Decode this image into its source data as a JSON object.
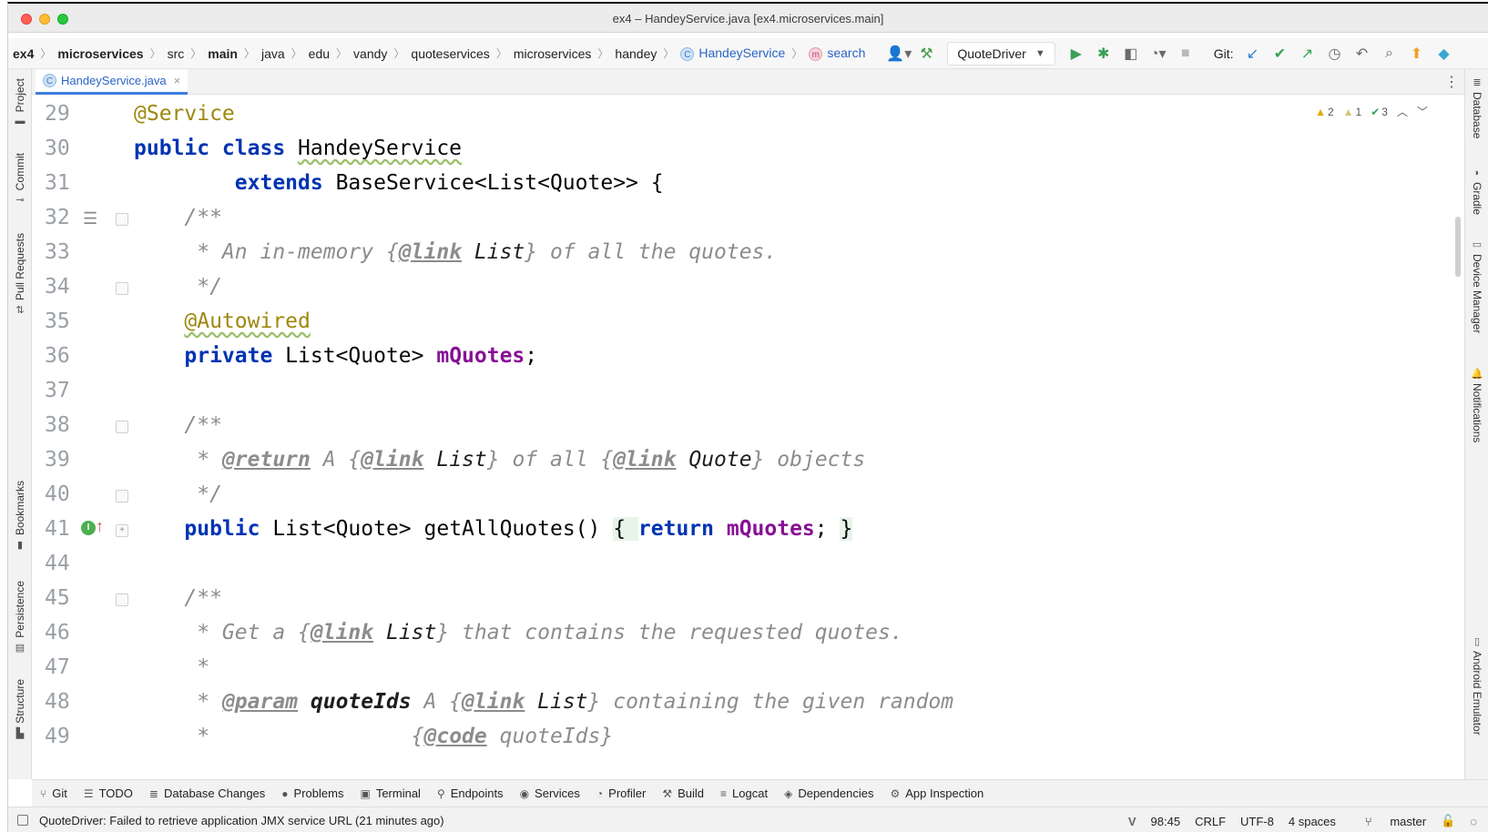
{
  "window": {
    "title": "ex4 – HandeyService.java [ex4.microservices.main]"
  },
  "breadcrumbs": [
    {
      "text": "ex4",
      "style": "bold"
    },
    {
      "text": "microservices",
      "style": "bold"
    },
    {
      "text": "src",
      "style": ""
    },
    {
      "text": "main",
      "style": "bold"
    },
    {
      "text": "java",
      "style": ""
    },
    {
      "text": "edu",
      "style": ""
    },
    {
      "text": "vandy",
      "style": ""
    },
    {
      "text": "quoteservices",
      "style": ""
    },
    {
      "text": "microservices",
      "style": ""
    },
    {
      "text": "handey",
      "style": ""
    }
  ],
  "breadcrumb_class": {
    "icon": "C",
    "label": "HandeyService"
  },
  "breadcrumb_method": {
    "icon": "m",
    "label": "search"
  },
  "toolbar": {
    "run_config": "QuoteDriver",
    "git_label": "Git:",
    "icons": [
      "user-icon",
      "hammer-icon",
      "run-icon",
      "debug-icon",
      "coverage-icon",
      "profile-icon",
      "stop-icon",
      "git-update-icon",
      "git-commit-icon",
      "git-push-icon",
      "history-icon",
      "rollback-icon",
      "search-icon",
      "update-icon",
      "plugin-icon"
    ]
  },
  "tab": {
    "icon": "C",
    "label": "HandeyService.java",
    "close": "×"
  },
  "inspections": {
    "warnings": "2",
    "weak_warnings": "1",
    "ok": "3"
  },
  "left_tools": [
    {
      "label": "Project",
      "icon": "folder-icon"
    },
    {
      "label": "Commit",
      "icon": "commit-icon"
    },
    {
      "label": "Pull Requests",
      "icon": "pull-request-icon"
    },
    {
      "label": "Bookmarks",
      "icon": "bookmark-icon"
    },
    {
      "label": "Persistence",
      "icon": "persistence-icon"
    },
    {
      "label": "Structure",
      "icon": "structure-icon"
    }
  ],
  "right_tools": [
    {
      "label": "Database",
      "icon": "database-icon"
    },
    {
      "label": "Gradle",
      "icon": "gradle-icon"
    },
    {
      "label": "Device Manager",
      "icon": "device-icon"
    },
    {
      "label": "Notifications",
      "icon": "bell-icon"
    },
    {
      "label": "Android Emulator",
      "icon": "emulator-icon"
    }
  ],
  "code_lines": [
    {
      "num": "29",
      "segs": [
        {
          "t": "@Service",
          "c": "ann"
        }
      ]
    },
    {
      "num": "30",
      "segs": [
        {
          "t": "public class ",
          "c": "kw"
        },
        {
          "t": "HandeyService",
          "c": "cls-wavy"
        }
      ]
    },
    {
      "num": "31",
      "segs": [
        {
          "t": "        ",
          "c": ""
        },
        {
          "t": "extends ",
          "c": "kw"
        },
        {
          "t": "BaseService<List<Quote>> {",
          "c": ""
        }
      ]
    },
    {
      "num": "32",
      "segs": [
        {
          "t": "    /**",
          "c": "doc"
        }
      ]
    },
    {
      "num": "33",
      "segs": [
        {
          "t": "     * An in-memory {",
          "c": "doc"
        },
        {
          "t": "@link",
          "c": "doctag"
        },
        {
          "t": " List",
          "c": "docref"
        },
        {
          "t": "} of all the quotes.",
          "c": "doc"
        }
      ]
    },
    {
      "num": "34",
      "segs": [
        {
          "t": "     */",
          "c": "doc"
        }
      ]
    },
    {
      "num": "35",
      "segs": [
        {
          "t": "    ",
          "c": ""
        },
        {
          "t": "@Autowired",
          "c": "ann-wavy"
        }
      ]
    },
    {
      "num": "36",
      "segs": [
        {
          "t": "    ",
          "c": ""
        },
        {
          "t": "private ",
          "c": "kw"
        },
        {
          "t": "List<Quote> ",
          "c": ""
        },
        {
          "t": "mQuotes",
          "c": "fld"
        },
        {
          "t": ";",
          "c": ""
        }
      ]
    },
    {
      "num": "37",
      "segs": []
    },
    {
      "num": "38",
      "segs": [
        {
          "t": "    /**",
          "c": "doc"
        }
      ]
    },
    {
      "num": "39",
      "segs": [
        {
          "t": "     * ",
          "c": "doc"
        },
        {
          "t": "@return",
          "c": "doctag"
        },
        {
          "t": " A {",
          "c": "doc"
        },
        {
          "t": "@link",
          "c": "doctag"
        },
        {
          "t": " List",
          "c": "docref"
        },
        {
          "t": "} of all {",
          "c": "doc"
        },
        {
          "t": "@link",
          "c": "doctag"
        },
        {
          "t": " Quote",
          "c": "docref"
        },
        {
          "t": "} objects",
          "c": "doc"
        }
      ]
    },
    {
      "num": "40",
      "segs": [
        {
          "t": "     */",
          "c": "doc"
        }
      ]
    },
    {
      "num": "41",
      "segs": [
        {
          "t": "    ",
          "c": ""
        },
        {
          "t": "public ",
          "c": "kw"
        },
        {
          "t": "List<Quote> getAllQuotes() ",
          "c": ""
        },
        {
          "t": "{ ",
          "c": "brace-hl"
        },
        {
          "t": "return ",
          "c": "kw"
        },
        {
          "t": "mQuotes",
          "c": "fld"
        },
        {
          "t": "; ",
          "c": ""
        },
        {
          "t": "}",
          "c": "brace-hl"
        }
      ]
    },
    {
      "num": "44",
      "segs": []
    },
    {
      "num": "45",
      "segs": [
        {
          "t": "    /**",
          "c": "doc"
        }
      ]
    },
    {
      "num": "46",
      "segs": [
        {
          "t": "     * Get a {",
          "c": "doc"
        },
        {
          "t": "@link",
          "c": "doctag"
        },
        {
          "t": " List",
          "c": "docref"
        },
        {
          "t": "} that contains the requested quotes.",
          "c": "doc"
        }
      ]
    },
    {
      "num": "47",
      "segs": [
        {
          "t": "     *",
          "c": "doc"
        }
      ]
    },
    {
      "num": "48",
      "segs": [
        {
          "t": "     * ",
          "c": "doc"
        },
        {
          "t": "@param",
          "c": "doctag"
        },
        {
          "t": " quoteIds",
          "c": "docparam"
        },
        {
          "t": " A {",
          "c": "doc"
        },
        {
          "t": "@link",
          "c": "doctag"
        },
        {
          "t": " List",
          "c": "docref"
        },
        {
          "t": "} containing the given random",
          "c": "doc"
        }
      ]
    },
    {
      "num": "49",
      "segs": [
        {
          "t": "     *                {",
          "c": "doc"
        },
        {
          "t": "@code",
          "c": "doctag"
        },
        {
          "t": " quoteIds}",
          "c": "doc"
        }
      ]
    }
  ],
  "bottom_tools": [
    {
      "label": "Git",
      "icon": "git-branch-icon"
    },
    {
      "label": "TODO",
      "icon": "list-icon"
    },
    {
      "label": "Database Changes",
      "icon": "database-changes-icon"
    },
    {
      "label": "Problems",
      "icon": "problems-icon"
    },
    {
      "label": "Terminal",
      "icon": "terminal-icon"
    },
    {
      "label": "Endpoints",
      "icon": "endpoints-icon"
    },
    {
      "label": "Services",
      "icon": "services-icon"
    },
    {
      "label": "Profiler",
      "icon": "profiler-icon"
    },
    {
      "label": "Build",
      "icon": "hammer-icon"
    },
    {
      "label": "Logcat",
      "icon": "logcat-icon"
    },
    {
      "label": "Dependencies",
      "icon": "dependencies-icon"
    },
    {
      "label": "App Inspection",
      "icon": "app-inspection-icon"
    }
  ],
  "status": {
    "message": "QuoteDriver: Failed to retrieve application JMX service URL (21 minutes ago)",
    "position": "98:45",
    "line_ending": "CRLF",
    "encoding": "UTF-8",
    "indent": "4 spaces",
    "branch": "master"
  },
  "colors": {
    "keyword": "#0033b3",
    "annotation": "#9e880d",
    "field": "#871094",
    "comment": "#8c8c8c",
    "link": "#2a64c8"
  }
}
